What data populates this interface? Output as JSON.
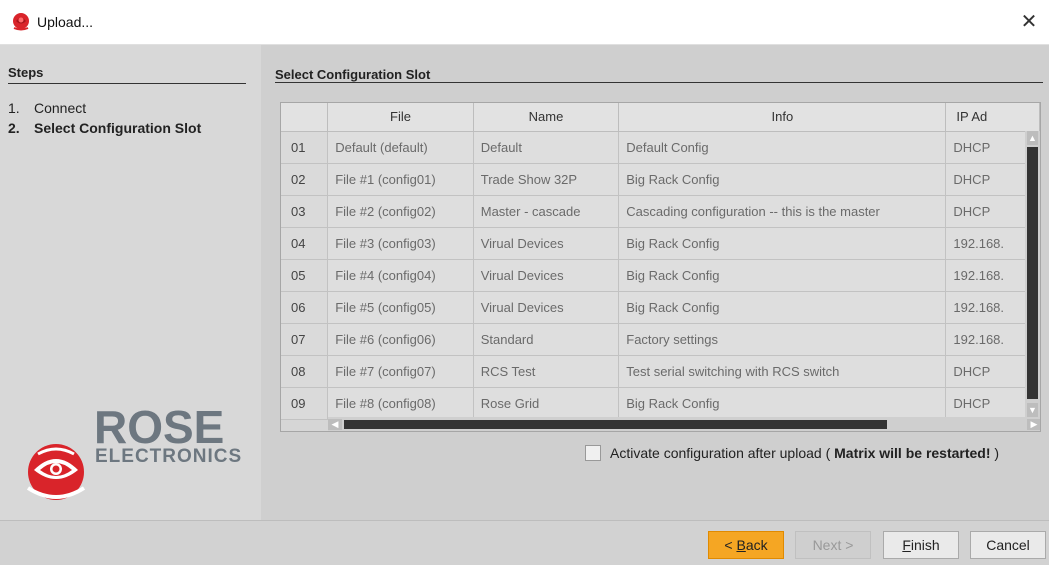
{
  "window": {
    "title": "Upload...",
    "close_icon": "close-icon"
  },
  "steps": {
    "title": "Steps",
    "items": [
      {
        "num": "1.",
        "label": "Connect"
      },
      {
        "num": "2.",
        "label": "Select Configuration Slot"
      }
    ]
  },
  "logo": {
    "word1": "ROSE",
    "word2": "ELECTRONICS",
    "icon": "rose-logo-icon"
  },
  "main": {
    "title": "Select Configuration Slot",
    "table": {
      "columns": [
        "",
        "File",
        "Name",
        "Info",
        "IP Ad"
      ],
      "rows": [
        [
          "01",
          "Default (default)",
          "Default",
          "Default Config",
          "DHCP"
        ],
        [
          "02",
          "File #1 (config01)",
          "Trade Show 32P",
          "Big Rack Config",
          "DHCP"
        ],
        [
          "03",
          "File #2 (config02)",
          "Master - cascade",
          "Cascading configuration -- this is the master",
          "DHCP"
        ],
        [
          "04",
          "File #3 (config03)",
          "Virual Devices",
          "Big Rack Config",
          "192.168."
        ],
        [
          "05",
          "File #4 (config04)",
          "Virual Devices",
          "Big Rack Config",
          "192.168."
        ],
        [
          "06",
          "File #5 (config05)",
          "Virual Devices",
          "Big Rack Config",
          "192.168."
        ],
        [
          "07",
          "File #6 (config06)",
          "Standard",
          "Factory settings",
          "192.168."
        ],
        [
          "08",
          "File #7 (config07)",
          "RCS Test",
          "Test serial switching with RCS switch",
          "DHCP"
        ],
        [
          "09",
          "File #8 (config08)",
          "Rose Grid",
          "Big Rack Config",
          "DHCP"
        ]
      ]
    },
    "activate": {
      "prefix": "Activate configuration after upload ( ",
      "bold": "Matrix will be restarted!",
      "suffix": " )",
      "checked": false
    }
  },
  "footer": {
    "back_pre": "< ",
    "back_u": "B",
    "back_post": "ack",
    "next": "Next >",
    "finish_u": "F",
    "finish_post": "inish",
    "cancel": "Cancel"
  },
  "colors": {
    "accent": "#f5a623",
    "logo_red": "#d9242a",
    "logo_grey": "#6d7780"
  }
}
